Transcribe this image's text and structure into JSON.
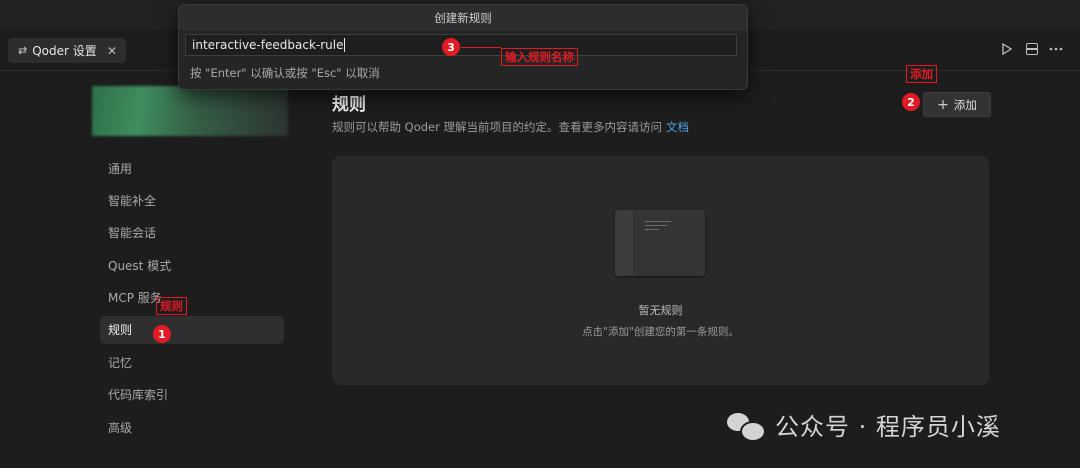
{
  "tab": {
    "label": "Qoder 设置",
    "icon": "settings-sliders-icon",
    "close": "✕"
  },
  "toolbar_icons": [
    "run-icon",
    "split-editor-icon",
    "more-icon"
  ],
  "dialog": {
    "title": "创建新规则",
    "input_value": "interactive-feedback-rule",
    "hint": "按 \"Enter\" 以确认或按 \"Esc\" 以取消"
  },
  "sidebar": {
    "items": [
      {
        "label": "通用",
        "active": false
      },
      {
        "label": "智能补全",
        "active": false
      },
      {
        "label": "智能会话",
        "active": false
      },
      {
        "label": "Quest 模式",
        "active": false
      },
      {
        "label": "MCP 服务",
        "active": false
      },
      {
        "label": "规则",
        "active": true
      },
      {
        "label": "记忆",
        "active": false
      },
      {
        "label": "代码库索引",
        "active": false
      },
      {
        "label": "高级",
        "active": false
      }
    ]
  },
  "main": {
    "title": "规则",
    "description": "规则可以帮助 Qoder 理解当前项目的约定。查看更多内容请访问",
    "doc_link": "文档",
    "add_button": "添加",
    "empty_title": "暂无规则",
    "empty_subtitle": "点击\"添加\"创建您的第一条规则。"
  },
  "annotations": {
    "step1": "1",
    "step1_label": "规则",
    "step2": "2",
    "step2_label": "添加",
    "step3": "3",
    "step3_label": "输入规则名称",
    "color": "#e11b23"
  },
  "watermark": "公众号 · 程序员小溪"
}
